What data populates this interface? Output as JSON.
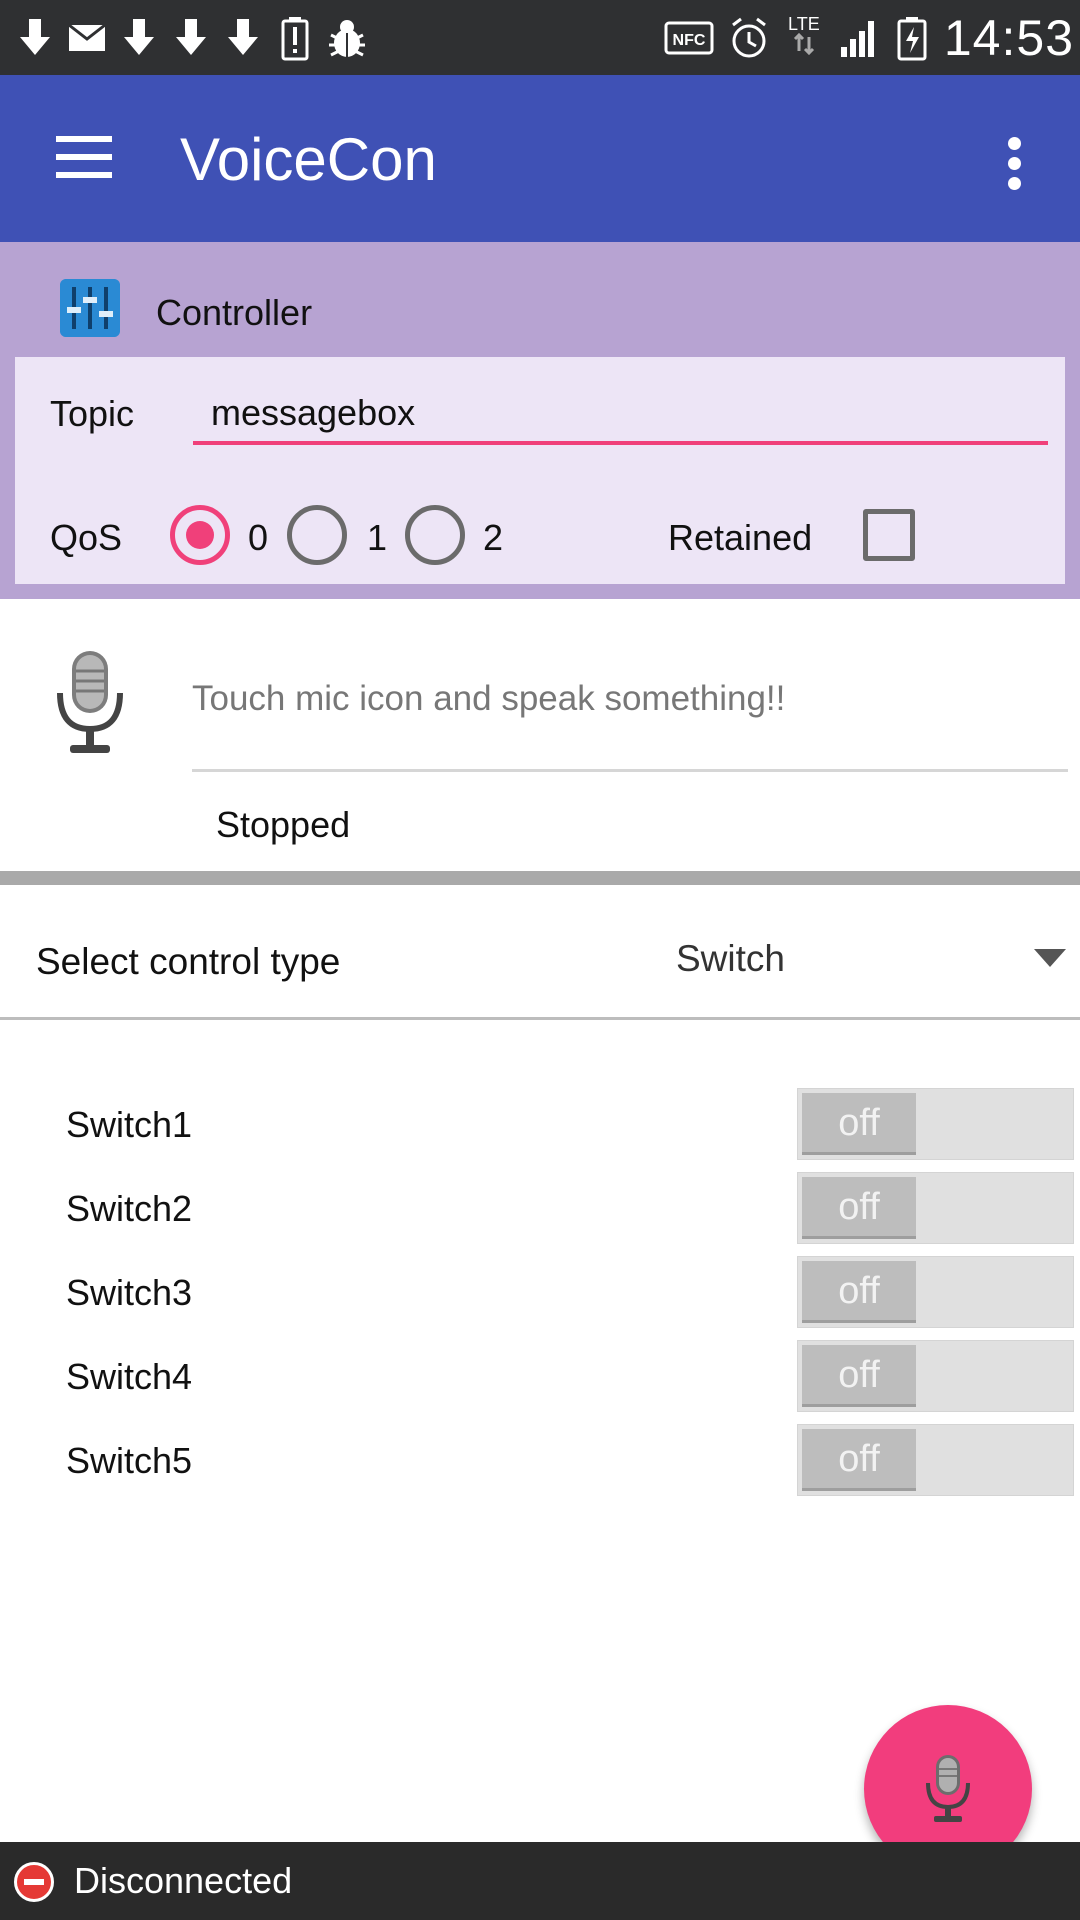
{
  "status_bar": {
    "left_icons": [
      "download-icon",
      "mail-icon",
      "download-icon",
      "download-icon",
      "download-icon",
      "battery-alert-icon",
      "bug-icon"
    ],
    "right_icons": [
      "nfc-icon",
      "alarm-icon",
      "lte-icon",
      "signal-icon",
      "battery-charging-icon"
    ],
    "nfc": "NFC",
    "lte": "LTE",
    "time": "14:53"
  },
  "app_bar": {
    "title": "VoiceCon",
    "menu_icon": "hamburger-menu-icon",
    "overflow_icon": "more-vert-icon",
    "color": "#3f51b5"
  },
  "controller": {
    "title": "Controller",
    "icon": "equalizer-icon",
    "topic_label": "Topic",
    "topic_value": "messagebox",
    "qos_label": "QoS",
    "qos_options": [
      "0",
      "1",
      "2"
    ],
    "qos_selected": "0",
    "retained_label": "Retained",
    "retained_checked": false,
    "accent": "#f0407a"
  },
  "voice": {
    "mic_icon": "microphone-icon",
    "prompt": "Touch mic icon and speak something!!",
    "status": "Stopped"
  },
  "control_select": {
    "label": "Select control type",
    "value": "Switch"
  },
  "switches": [
    {
      "label": "Switch1",
      "state": "off"
    },
    {
      "label": "Switch2",
      "state": "off"
    },
    {
      "label": "Switch3",
      "state": "off"
    },
    {
      "label": "Switch4",
      "state": "off"
    },
    {
      "label": "Switch5",
      "state": "off"
    }
  ],
  "fab": {
    "icon": "microphone-icon",
    "color": "#f23d7d"
  },
  "connection": {
    "icon": "disconnected-icon",
    "text": "Disconnected"
  }
}
